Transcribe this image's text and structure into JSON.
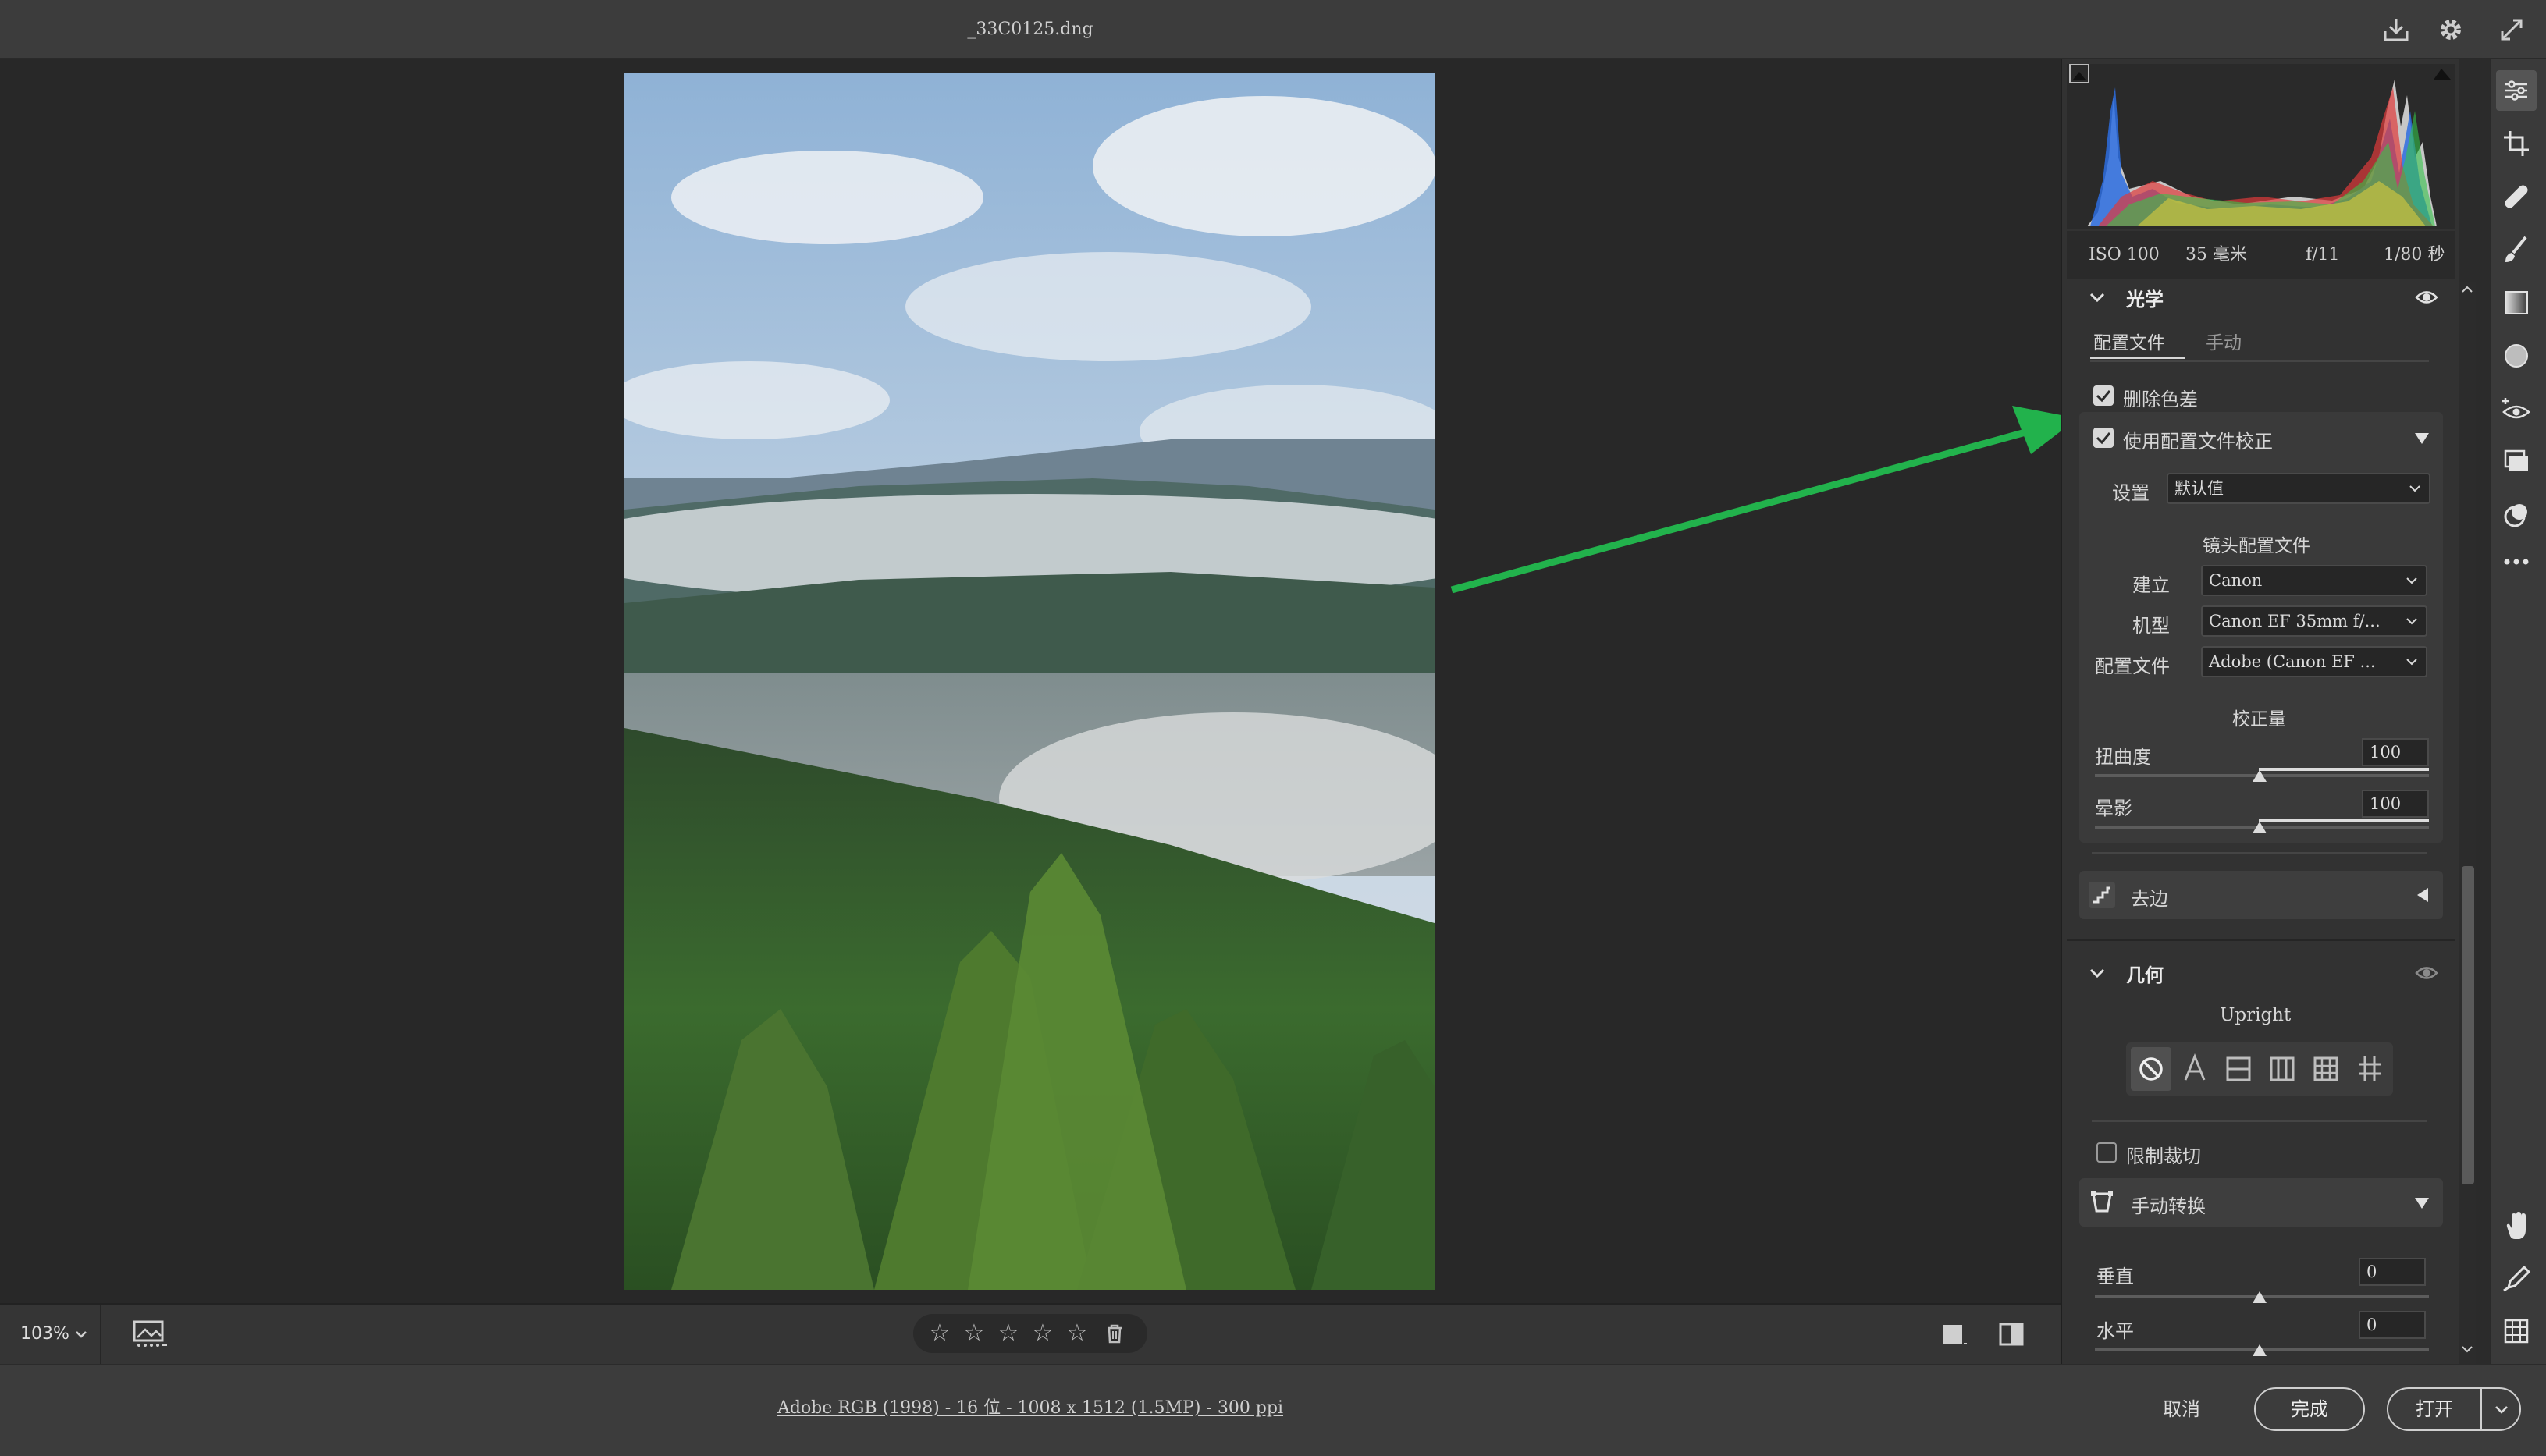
{
  "window": {
    "filename": "_33C0125.dng"
  },
  "toolbar_icons": [
    "save-icon",
    "gear-icon",
    "fullscreen-icon"
  ],
  "zoom": {
    "value": "103%"
  },
  "rating": {
    "stars": [
      "☆",
      "☆",
      "☆",
      "☆",
      "☆"
    ],
    "current": 0
  },
  "footer": {
    "workflow": "Adobe RGB (1998) - 16 位 - 1008 x 1512 (1.5MP) - 300 ppi",
    "cancel": "取消",
    "done": "完成",
    "open": "打开"
  },
  "exif": {
    "iso": "ISO 100",
    "focal": "35 毫米",
    "aperture": "f/11",
    "shutter": "1/80 秒"
  },
  "optics": {
    "title": "光学",
    "tabs": [
      "配置文件",
      "手动"
    ],
    "remove_ca": "删除色差",
    "use_profile": "使用配置文件校正",
    "setup_label": "设置",
    "setup_value": "默认值",
    "lens_profile_heading": "镜头配置文件",
    "make_label": "建立",
    "make_value": "Canon",
    "model_label": "机型",
    "model_value": "Canon EF 35mm f/...",
    "profile_label": "配置文件",
    "profile_value": "Adobe (Canon EF ...",
    "amount_heading": "校正量",
    "distortion_label": "扭曲度",
    "distortion_value": "100",
    "vignette_label": "晕影",
    "vignette_value": "100",
    "defringe_label": "去边"
  },
  "geometry": {
    "title": "几何",
    "upright_label": "Upright",
    "constrain_crop": "限制裁切",
    "manual_transform": "手动转换",
    "vertical_label": "垂直",
    "vertical_value": "0",
    "horizontal_label": "水平",
    "horizontal_value": "0"
  },
  "colors": {
    "accent_arrow": "#22b24c",
    "panel_bg": "#323232"
  }
}
